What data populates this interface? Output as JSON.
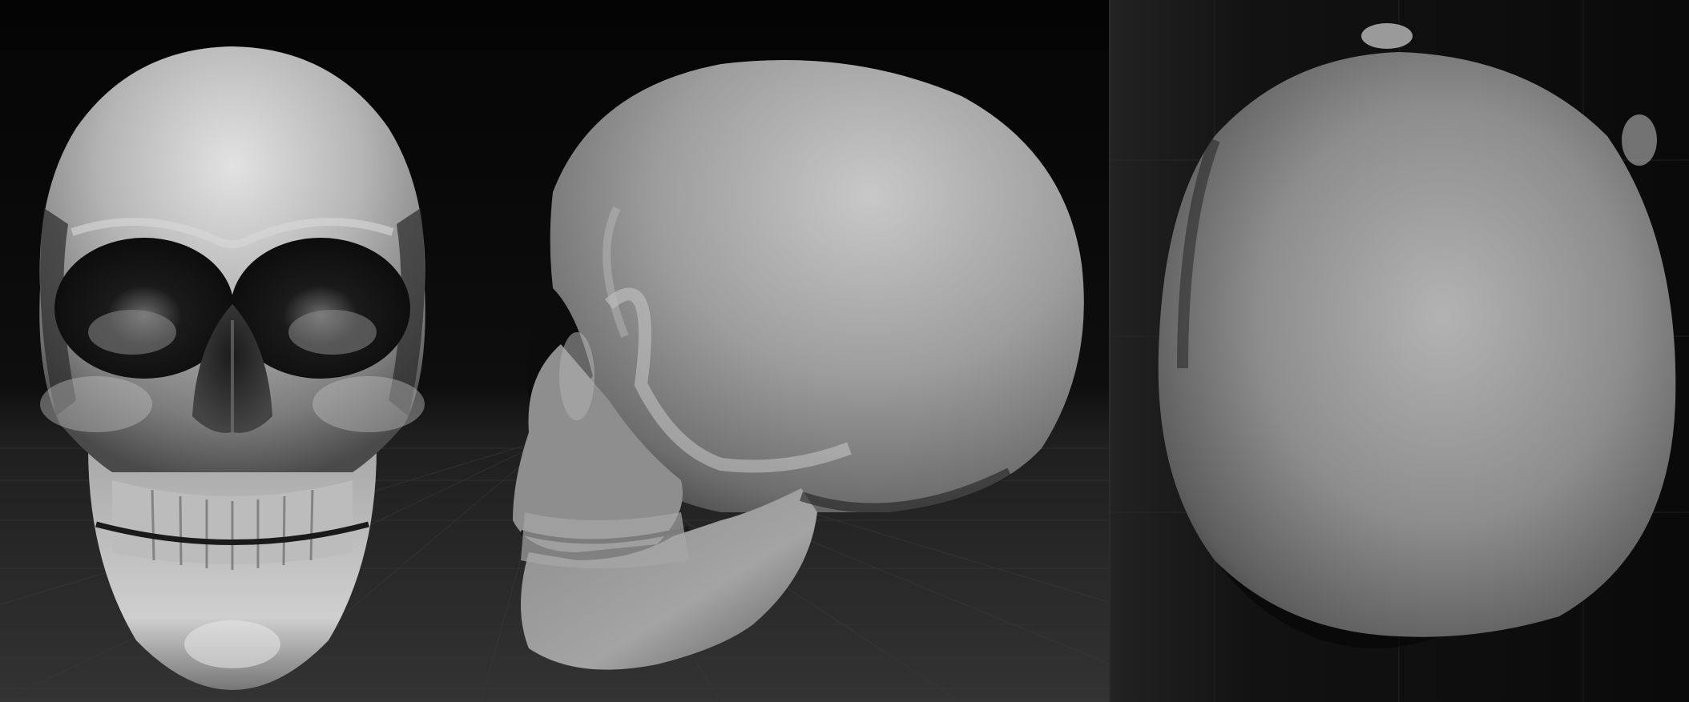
{
  "scene": {
    "views": [
      {
        "id": "front",
        "subject": "skull-front-view"
      },
      {
        "id": "side",
        "subject": "skull-side-view"
      },
      {
        "id": "top",
        "subject": "skull-top-view"
      }
    ],
    "colors": {
      "background_top": "#050505",
      "floor": "#2f2f2f",
      "grid_line": "#3d3d3d",
      "skull_light": "#d9d9d9",
      "skull_mid": "#9a9a9a",
      "skull_dark": "#3a3a3a",
      "cavity": "#0b0b0b",
      "top_panel_bg": "#2c2c2c"
    }
  }
}
